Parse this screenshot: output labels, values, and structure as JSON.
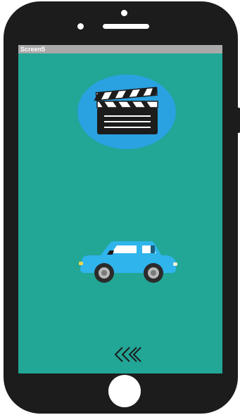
{
  "screen": {
    "title": "Screen5",
    "background": "#22a696",
    "titlebar_color": "#a9a9a9"
  },
  "icons": {
    "clapperboard": "clapperboard-icon",
    "car": "car-icon",
    "back": "chevrons-left-icon"
  },
  "colors": {
    "phone_body": "#1c1c1c",
    "icon_circle": "#2aa1e0",
    "car_body": "#2fb4ec"
  }
}
